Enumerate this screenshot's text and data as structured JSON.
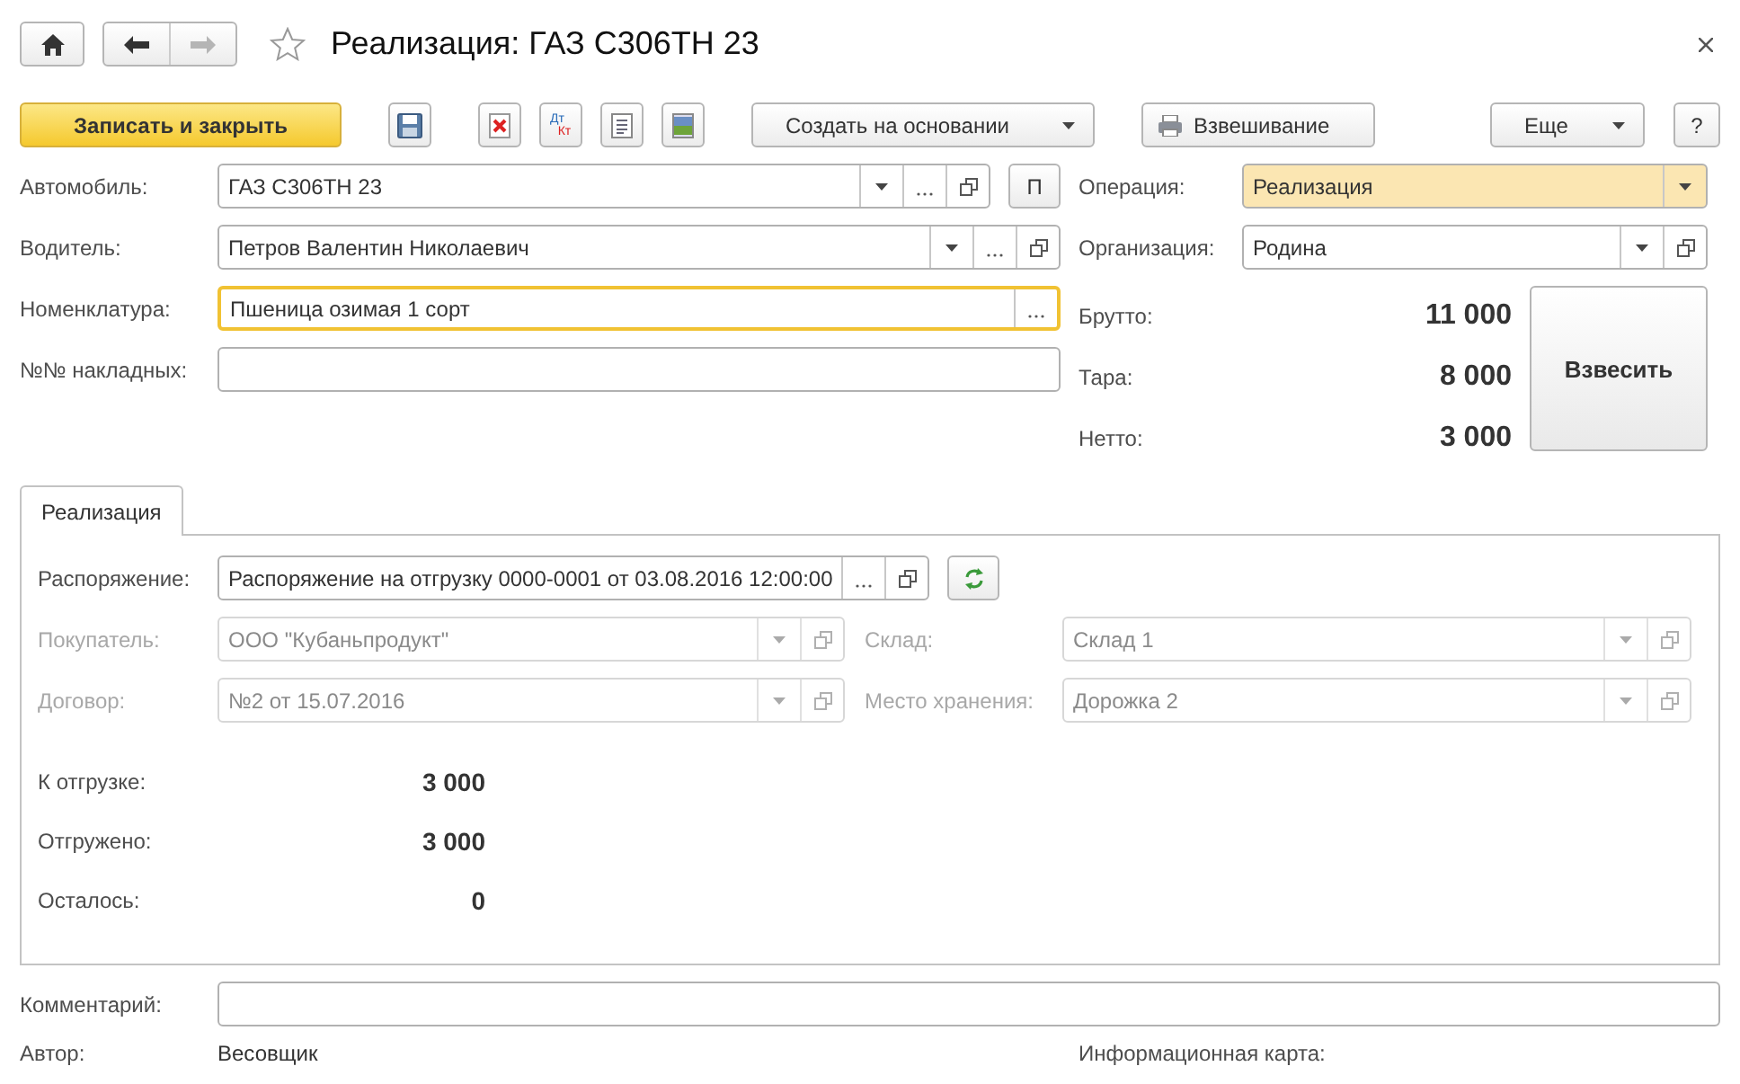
{
  "window": {
    "title": "Реализация: ГАЗ С306ТН 23",
    "favorite": false
  },
  "nav": [
    {
      "kind": "back",
      "disabled": false
    },
    {
      "kind": "forward",
      "disabled": true
    }
  ],
  "toolbar": {
    "left": [
      [
        {
          "kind": "primary",
          "label": "Записать и закрыть"
        }
      ],
      [
        {
          "kind": "save"
        }
      ],
      [
        {
          "kind": "delete"
        },
        {
          "kind": "postings",
          "labels": [
            "Дт",
            "Кт"
          ]
        },
        {
          "kind": "report"
        },
        {
          "kind": "preview"
        }
      ],
      [
        {
          "kind": "menu",
          "label": "Создать на основании"
        }
      ],
      [
        {
          "kind": "print",
          "label": "Взвешивание"
        }
      ]
    ],
    "right": [
      [
        {
          "kind": "menu",
          "label": "Еще"
        }
      ],
      [
        {
          "kind": "help",
          "label": "?"
        }
      ]
    ]
  },
  "header_fields": {
    "left": [
      {
        "label": "Автомобиль:",
        "value": "ГАЗ С306ТН 23",
        "dropdown": true,
        "select": true,
        "open": true,
        "extra_button": "П",
        "focused": false,
        "highlighted": false
      },
      {
        "label": "Водитель:",
        "value": "Петров Валентин Николаевич",
        "dropdown": true,
        "select": true,
        "open": true,
        "focused": false,
        "highlighted": false
      },
      {
        "label": "Номенклатура:",
        "value": "Пшеница озимая 1 сорт",
        "dropdown": false,
        "select": true,
        "open": false,
        "focused": true,
        "highlighted": false
      },
      {
        "label": "№№ накладных:",
        "dropdown": false,
        "select": false,
        "open": false,
        "focused": false,
        "highlighted": false
      }
    ],
    "right": [
      {
        "label": "Операция:",
        "value": "Реализация",
        "dropdown": true,
        "select": false,
        "open": false,
        "focused": false,
        "highlighted": true
      },
      {
        "label": "Организация:",
        "value": "Родина",
        "dropdown": true,
        "select": false,
        "open": true,
        "focused": false,
        "highlighted": false
      }
    ]
  },
  "weights": [
    {
      "label": "Брутто:",
      "value": "11 000"
    },
    {
      "label": "Тара:",
      "value": "8 000"
    },
    {
      "label": "Нетто:",
      "value": "3 000"
    }
  ],
  "weigh_button": "Взвесить",
  "tabs": [
    {
      "label": "Реализация",
      "selected": true
    }
  ],
  "tab_panel": {
    "order": {
      "label": "Распоряжение:",
      "value": "Распоряжение на отгрузку 0000-0001 от 03.08.2016 12:00:00",
      "dropdown": false,
      "select": true,
      "open": true,
      "disabled": false
    },
    "left": [
      {
        "label": "Покупатель:",
        "value": "ООО \"Кубаньпродукт\"",
        "dropdown": true,
        "select": false,
        "open": true,
        "disabled": true
      },
      {
        "label": "Договор:",
        "value": "№2 от 15.07.2016",
        "dropdown": true,
        "select": false,
        "open": true,
        "disabled": true
      }
    ],
    "right": [
      {
        "label": "Склад:",
        "value": "Склад 1",
        "dropdown": true,
        "select": false,
        "open": true,
        "disabled": true
      },
      {
        "label": "Место хранения:",
        "value": "Дорожка 2",
        "dropdown": true,
        "select": false,
        "open": true,
        "disabled": true
      }
    ],
    "totals": [
      {
        "label": "К отгрузке:",
        "value": "3 000"
      },
      {
        "label": "Отгружено:",
        "value": "3 000"
      },
      {
        "label": "Осталось:",
        "value": "0"
      }
    ]
  },
  "comment": {
    "label": "Комментарий:"
  },
  "footer": [
    {
      "label": "Автор:",
      "value": "Весовщик"
    },
    {
      "label": "Информационная карта:"
    }
  ]
}
